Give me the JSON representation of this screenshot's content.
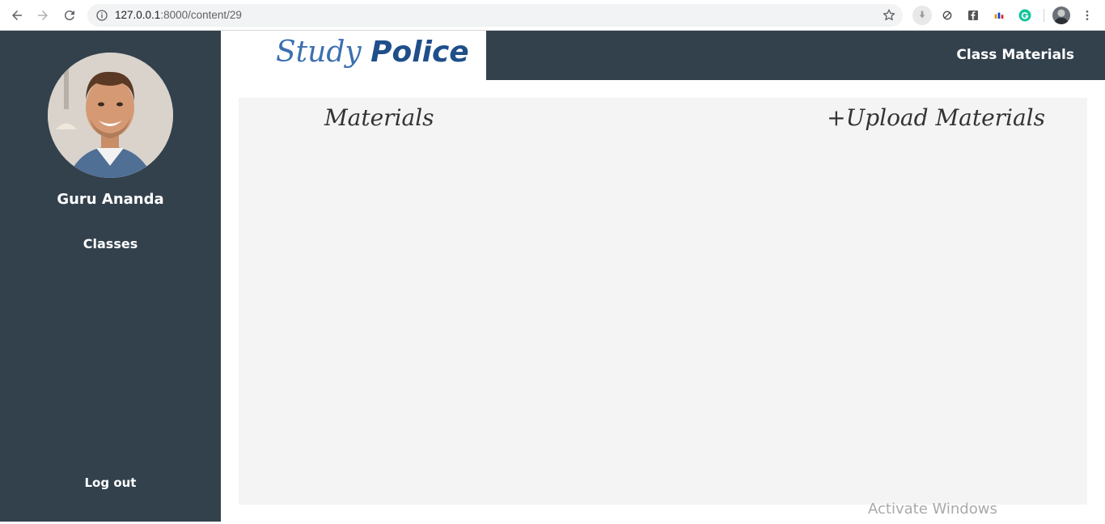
{
  "browser": {
    "url_host": "127.0.0.1",
    "url_path": ":8000/content/29"
  },
  "app": {
    "logo_word1": "Study",
    "logo_word2": "Police",
    "header_title": "Class Materials"
  },
  "sidebar": {
    "user_name": "Guru Ananda",
    "nav_classes": "Classes",
    "logout": "Log out"
  },
  "main": {
    "title": "Materials",
    "upload_label": "+Upload Materials"
  },
  "os": {
    "watermark": "Activate Windows"
  },
  "colors": {
    "sidebar_bg": "#33414d",
    "panel_bg": "#f4f4f4",
    "logo_blue": "#3b6fb0"
  }
}
